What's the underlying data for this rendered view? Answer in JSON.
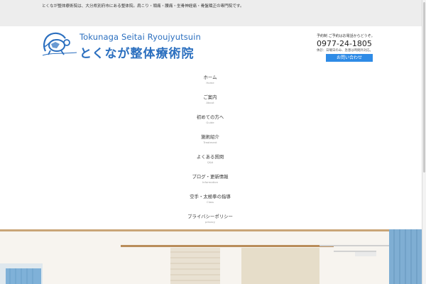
{
  "header": {
    "tagline": "とくなが整体療術院は、大分県別府市にある整体院。肩こり・頭痛・腰痛・坐骨神経痛・骨盤矯正の専門院です。"
  },
  "logo": {
    "roman": "Tokunaga Seitai Ryoujyutsuin",
    "kanji": "とくなが整体療術院"
  },
  "contact": {
    "note": "予約制 ご予約はお電話からどうぞ。",
    "phone": "0977-24-1805",
    "hours": "休診：日曜日のみ、急患は時間外対応。",
    "button_label": "お問い合わせ"
  },
  "nav": {
    "items": [
      {
        "jp": "ホーム",
        "en": "Home"
      },
      {
        "jp": "ご案内",
        "en": "About"
      },
      {
        "jp": "初めての方へ",
        "en": "Guide"
      },
      {
        "jp": "施術紹介",
        "en": "Treatment"
      },
      {
        "jp": "よくある質問",
        "en": "Q&A"
      },
      {
        "jp": "ブログ・更新情報",
        "en": "Information"
      },
      {
        "jp": "空手・太極拳の指導",
        "en": "Class"
      },
      {
        "jp": "プライバシーポリシー",
        "en": "privacy"
      }
    ]
  },
  "colors": {
    "brand_blue": "#2b6fbf",
    "button_blue": "#2e8be6",
    "topbar_gray": "#ededed"
  }
}
